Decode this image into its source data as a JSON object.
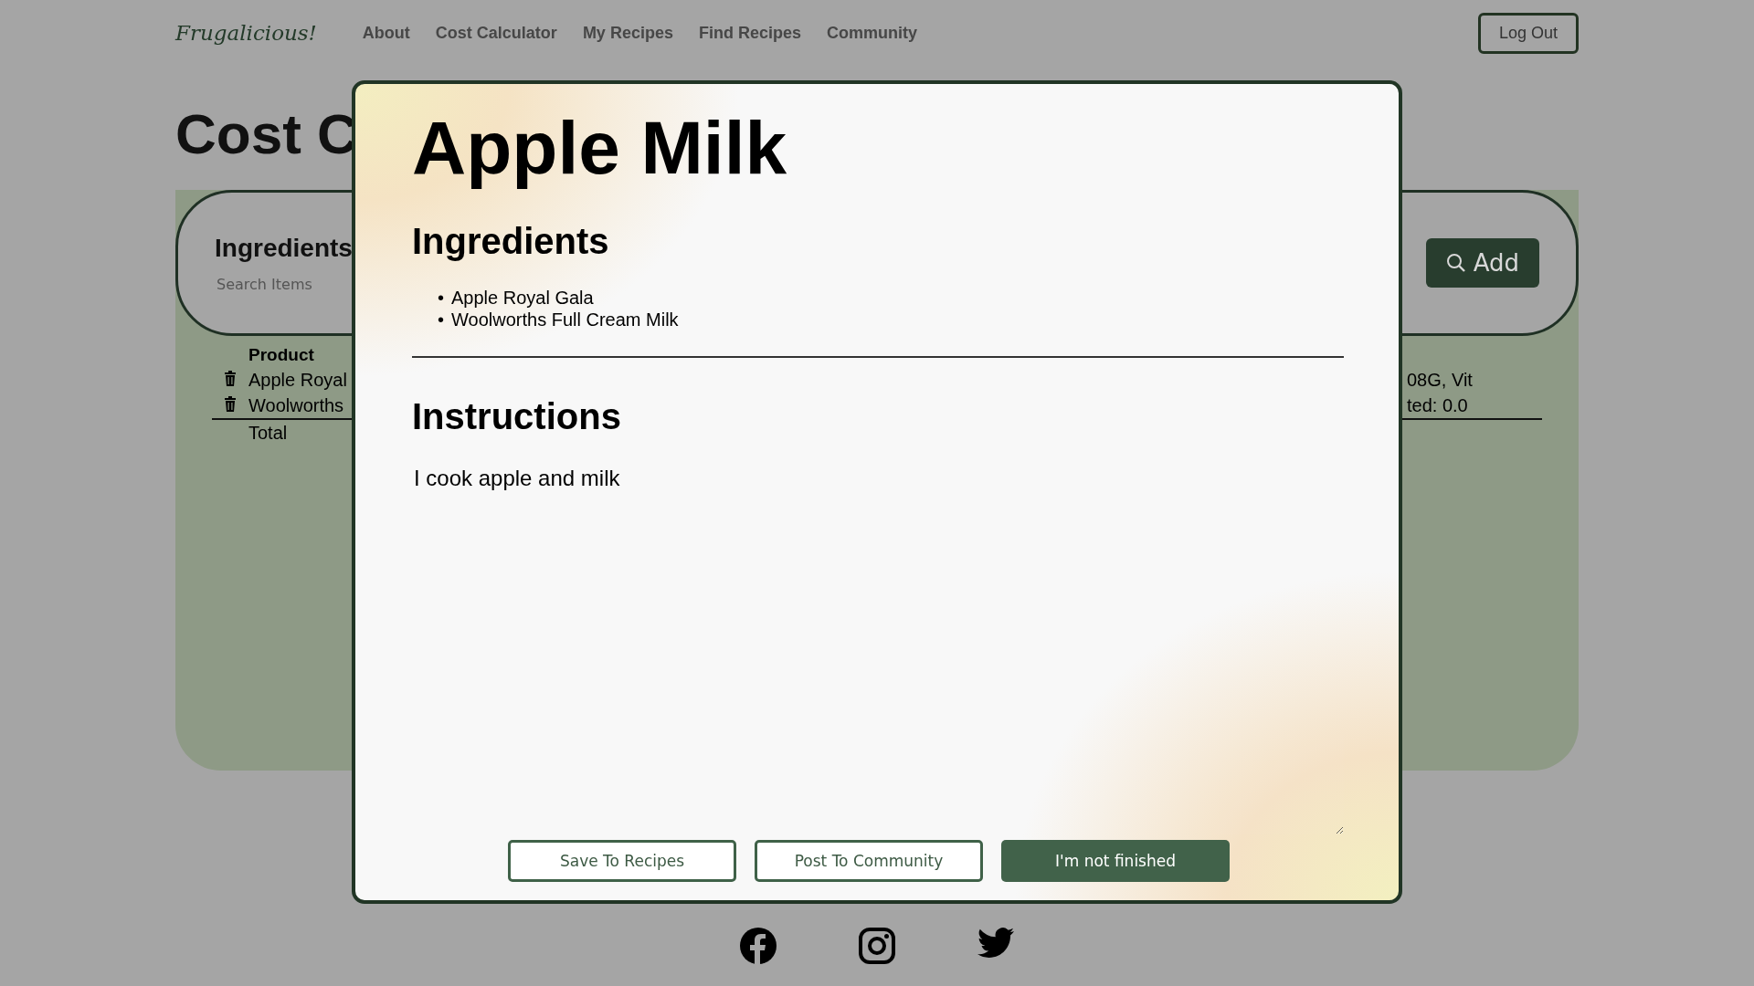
{
  "nav": {
    "logo": "Frugalicious!",
    "links": [
      "About",
      "Cost Calculator",
      "My Recipes",
      "Find Recipes",
      "Community"
    ],
    "logout": "Log Out"
  },
  "page": {
    "title": "Cost C",
    "search": {
      "label": "Ingredients",
      "placeholder": "Search Items",
      "add": "Add"
    },
    "table": {
      "header": "Product",
      "rows": [
        {
          "product": "Apple Royal",
          "nutrition": "08G, Vit"
        },
        {
          "product": "Woolworths",
          "nutrition": "ted: 0.0"
        }
      ],
      "total": "Total"
    }
  },
  "modal": {
    "title": "Apple Milk",
    "ingredients_heading": "Ingredients",
    "bullet": "•",
    "ingredients": [
      "Apple Royal Gala",
      "Woolworths Full Cream Milk"
    ],
    "instructions_heading": "Instructions",
    "instructions": "I cook apple and milk",
    "buttons": [
      {
        "label": "Save To Recipes",
        "kind": "outline"
      },
      {
        "label": "Post To Community",
        "kind": "outline"
      },
      {
        "label": "I'm not finished",
        "kind": "filled"
      }
    ]
  }
}
